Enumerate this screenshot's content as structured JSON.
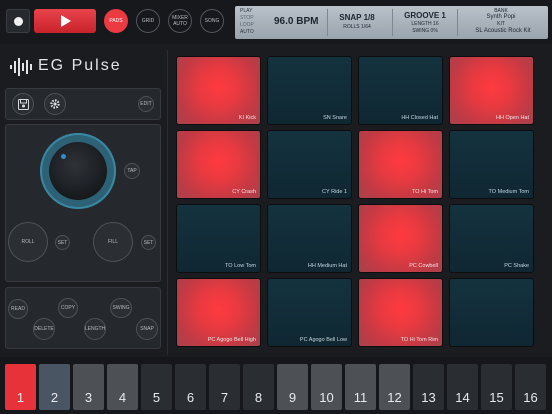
{
  "transport": {
    "record_icon": "record-dot",
    "play_icon": "play-triangle"
  },
  "modes": [
    {
      "label": "PADS",
      "active": true
    },
    {
      "label": "GRID",
      "active": false
    },
    {
      "label": "MIXER AUTO",
      "active": false
    },
    {
      "label": "SONG",
      "active": false
    }
  ],
  "lcd": {
    "left_labels": [
      "PLAY",
      "STOP",
      "LOOP",
      "AUTO"
    ],
    "bpm": "96.0 BPM",
    "snap": "SNAP 1/8",
    "rolls": "ROLLS 1/64",
    "groove": "GROOVE 1",
    "length": "LENGTH 16",
    "swing": "SWING 0%",
    "bank_label": "BANK",
    "bank_value": "Synth Popi",
    "kit_label": "KIT",
    "kit_value": "SL Acoustic Rock Kit"
  },
  "logo": {
    "text": "EG Pulse"
  },
  "controls": {
    "edit": "EDIT",
    "tap": "TAP",
    "roll": "ROLL",
    "roll_set": "SET",
    "fill": "FILL",
    "fill_set": "SET",
    "read": "READ",
    "copy": "COPY",
    "swing": "SWING",
    "delete": "DELETE",
    "length": "LENGTH",
    "snap": "SNAP"
  },
  "pads": [
    {
      "label": "KI Kick",
      "active": true
    },
    {
      "label": "SN Snare",
      "active": false
    },
    {
      "label": "HH Closed Hat",
      "active": false
    },
    {
      "label": "HH Open Hat",
      "active": true
    },
    {
      "label": "CY Crash",
      "active": true
    },
    {
      "label": "CY Ride 1",
      "active": false
    },
    {
      "label": "TO Hi Tom",
      "active": true
    },
    {
      "label": "TO Medium Tom",
      "active": false
    },
    {
      "label": "TO Low Tom",
      "active": false
    },
    {
      "label": "HH Medium Hat",
      "active": false
    },
    {
      "label": "PC Cowbell",
      "active": true
    },
    {
      "label": "PC Shake",
      "active": false
    },
    {
      "label": "PC Agogo Bell High",
      "active": true
    },
    {
      "label": "PC Agogo Bell Low",
      "active": false
    },
    {
      "label": "TO Hi Tom Rim",
      "active": true
    },
    {
      "label": "",
      "active": false
    }
  ],
  "steps": [
    {
      "label": "1",
      "state": "selected"
    },
    {
      "label": "2",
      "state": "current"
    },
    {
      "label": "3",
      "state": "bright"
    },
    {
      "label": "4",
      "state": "bright"
    },
    {
      "label": "5",
      "state": "dark"
    },
    {
      "label": "6",
      "state": "dark"
    },
    {
      "label": "7",
      "state": "dark"
    },
    {
      "label": "8",
      "state": "dark"
    },
    {
      "label": "9",
      "state": "bright"
    },
    {
      "label": "10",
      "state": "bright"
    },
    {
      "label": "11",
      "state": "bright"
    },
    {
      "label": "12",
      "state": "bright"
    },
    {
      "label": "13",
      "state": "dark"
    },
    {
      "label": "14",
      "state": "dark"
    },
    {
      "label": "15",
      "state": "dark"
    },
    {
      "label": "16",
      "state": "dark"
    }
  ],
  "colors": {
    "accent": "#ec3a42",
    "pad_on": "#e83a40",
    "pad_off": "#14323f",
    "step_selected": "#e8323a",
    "step_current": "#4a5563",
    "step_bright": "#4d5156",
    "step_dark": "#2a2d31"
  }
}
